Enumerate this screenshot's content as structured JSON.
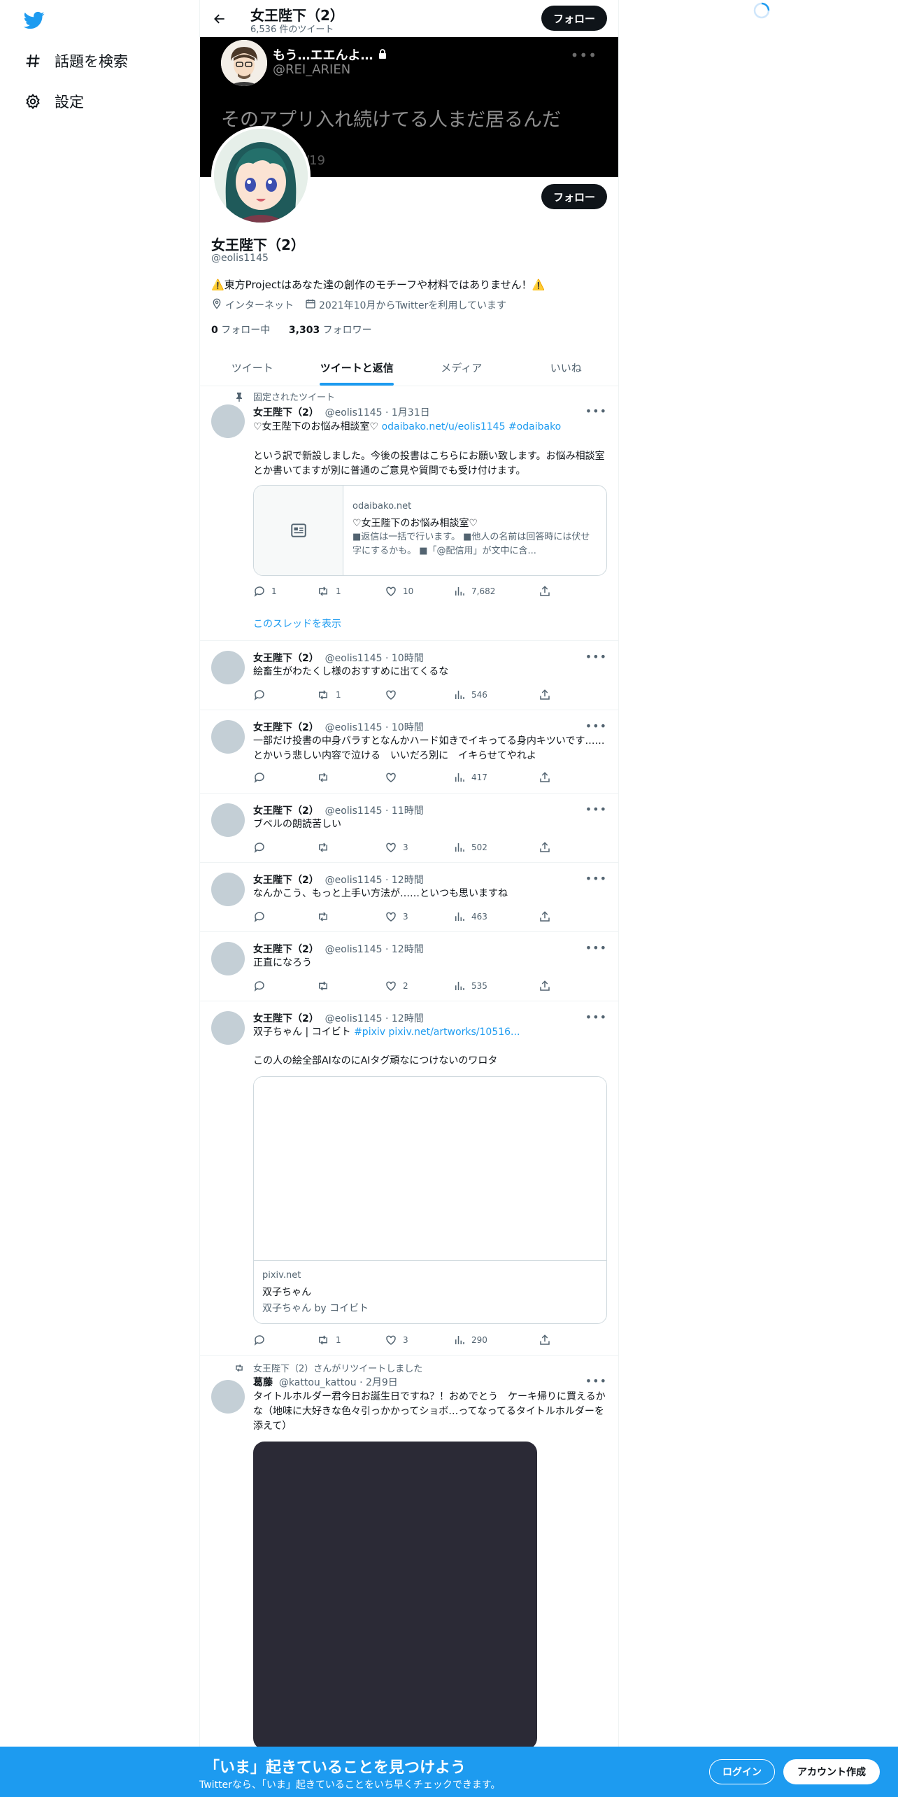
{
  "nav": {
    "explore_label": "話題を検索",
    "settings_label": "設定"
  },
  "header": {
    "title": "女王陛下（2）",
    "tweet_count": "6,536 件のツイート",
    "follow_label": "フォロー"
  },
  "banner": {
    "name": "もう…エエんよ…",
    "handle": "@REI_ARIEN",
    "text": "そのアプリ入れ続けてる人まだ居るんだ",
    "faint": "/19"
  },
  "profile": {
    "name": "女王陛下（2）",
    "handle": "@eolis1145",
    "bio": "⚠️東方Projectはあなた達の創作のモチーフや材料ではありません！⚠️",
    "location": "インターネット",
    "joined": "2021年10月からTwitterを利用しています",
    "following_count": "0",
    "following_label": " フォロー中",
    "followers_count": "3,303",
    "followers_label": " フォロワー",
    "follow_label": "フォロー"
  },
  "tabs": [
    "ツイート",
    "ツイートと返信",
    "メディア",
    "いいね"
  ],
  "pinned_label": "固定されたツイート",
  "show_thread_label": "このスレッドを表示",
  "tweets": [
    {
      "name": "女王陛下（2）",
      "meta": "@eolis1145 · 1月31日",
      "text_pre": "♡女王陛下のお悩み相談室♡ ",
      "link1": "odaibako.net/u/eolis1145",
      "link2": "#odaibako",
      "text_post": "という訳で新設しました。今後の投書はこちらにお願い致します。お悩み相談室とか書いてますが別に普通のご意見や質問でも受け付けます。",
      "card": {
        "domain": "odaibako.net",
        "title": "♡女王陛下のお悩み相談室♡",
        "desc": "■返信は一括で行います。 ■他人の名前は回答時には伏せ字にするかも。 ■「@配信用」が文中に含..."
      },
      "replies": "1",
      "retweets": "1",
      "likes": "10",
      "views": "7,682"
    },
    {
      "name": "女王陛下（2）",
      "meta": "@eolis1145 · 10時間",
      "text": "絵畜生がわたくし様のおすすめに出てくるな",
      "replies": "",
      "retweets": "1",
      "likes": "",
      "views": "546"
    },
    {
      "name": "女王陛下（2）",
      "meta": "@eolis1145 · 10時間",
      "text": "一部だけ投書の中身バラすとなんかハード如きでイキってる身内キツいです……とかいう悲しい内容で泣ける　いいだろ別に　イキらせてやれよ",
      "replies": "",
      "retweets": "",
      "likes": "",
      "views": "417"
    },
    {
      "name": "女王陛下（2）",
      "meta": "@eolis1145 · 11時間",
      "text": "ブベルの朗読苦しい",
      "replies": "",
      "retweets": "",
      "likes": "3",
      "views": "502"
    },
    {
      "name": "女王陛下（2）",
      "meta": "@eolis1145 · 12時間",
      "text": "なんかこう、もっと上手い方法が……といつも思いますね",
      "replies": "",
      "retweets": "",
      "likes": "3",
      "views": "463"
    },
    {
      "name": "女王陛下（2）",
      "meta": "@eolis1145 · 12時間",
      "text": "正直になろう",
      "replies": "",
      "retweets": "",
      "likes": "2",
      "views": "535"
    },
    {
      "name": "女王陛下（2）",
      "meta": "@eolis1145 · 12時間",
      "text_pre": "双子ちゃん | コイビト ",
      "link1": "#pixiv",
      "link2": "pixiv.net/artworks/10516...",
      "text_post": "この人の絵全部AIなのにAIタグ頑なにつけないのワロタ",
      "card": {
        "domain": "pixiv.net",
        "title": "双子ちゃん",
        "desc": "双子ちゃん by コイビト"
      },
      "replies": "",
      "retweets": "1",
      "likes": "3",
      "views": "290"
    },
    {
      "retweeted_by": "女王陛下（2）さんがリツイートしました",
      "name": "葛藤",
      "meta": "@kattou_kattou · 2月9日",
      "text": "タイトルホルダー君今日お誕生日ですね？！おめでとう　ケーキ帰りに買えるかな（地味に大好きな色々引っかかってショボ…ってなってるタイトルホルダーを添えて）"
    }
  ],
  "bottom": {
    "title": "「いま」起きていることを見つけよう",
    "subtitle": "Twitterなら、「いま」起きていることをいち早くチェックできます。",
    "login_label": "ログイン",
    "signup_label": "アカウント作成"
  },
  "colors": {
    "accent": "#1d9bf0",
    "text": "#0f1419",
    "muted": "#536471"
  }
}
